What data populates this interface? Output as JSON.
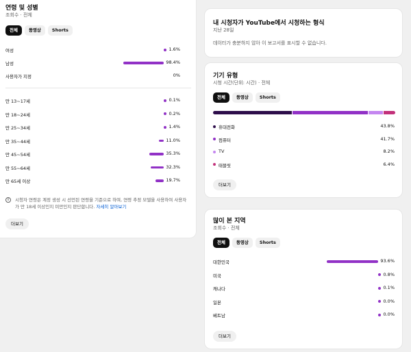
{
  "age_gender": {
    "title": "연령 및 성별",
    "subtitle": "조회수 · 전체",
    "chips": [
      "전체",
      "동영상",
      "Shorts"
    ],
    "gender": [
      {
        "label": "여성",
        "value": "1.6%",
        "pct": 1.6
      },
      {
        "label": "남성",
        "value": "98.4%",
        "pct": 98.4
      },
      {
        "label": "사용자가 지정",
        "value": "0%",
        "pct": 0
      }
    ],
    "ages": [
      {
        "label": "만 13~17세",
        "value": "0.1%",
        "pct": 0.1
      },
      {
        "label": "만 18~24세",
        "value": "0.2%",
        "pct": 0.2
      },
      {
        "label": "만 25~34세",
        "value": "1.4%",
        "pct": 1.4
      },
      {
        "label": "만 35~44세",
        "value": "11.0%",
        "pct": 11.0
      },
      {
        "label": "만 45~54세",
        "value": "35.3%",
        "pct": 35.3
      },
      {
        "label": "만 55~64세",
        "value": "32.3%",
        "pct": 32.3
      },
      {
        "label": "만 65세 이상",
        "value": "19.7%",
        "pct": 19.7
      }
    ],
    "info_text": "시청자 연령은 계정 생성 시 선언된 연령을 기준으로 하며, 연령 추정 모델을 사용하여 사용자가 만 18세 이상인지 미만인지 판단합니다.",
    "info_link": "자세히 알아보기",
    "more_label": "더보기"
  },
  "watch_format": {
    "title": "내 시청자가 YouTube에서 시청하는 형식",
    "subtitle": "지난 28일",
    "notice": "데이터가 충분하지 않아 이 보고서를 표시할 수 없습니다."
  },
  "device_type": {
    "title": "기기 유형",
    "subtitle": "시청 시간(단위: 시간) · 전체",
    "chips": [
      "전체",
      "동영상",
      "Shorts"
    ],
    "items": [
      {
        "label": "휴대전화",
        "value": "43.8%",
        "pct": 43.8,
        "color": "#2d0d4a"
      },
      {
        "label": "컴퓨터",
        "value": "41.7%",
        "pct": 41.7,
        "color": "#9131c6"
      },
      {
        "label": "TV",
        "value": "8.2%",
        "pct": 8.2,
        "color": "#c486f0"
      },
      {
        "label": "태블릿",
        "value": "6.4%",
        "pct": 6.4,
        "color": "#c2307a"
      }
    ],
    "more_label": "더보기"
  },
  "top_regions": {
    "title": "많이 본 지역",
    "subtitle": "조회수 · 전체",
    "chips": [
      "전체",
      "동영상",
      "Shorts"
    ],
    "items": [
      {
        "label": "대한민국",
        "value": "93.6%",
        "pct": 93.6
      },
      {
        "label": "미국",
        "value": "0.8%",
        "pct": 0.8
      },
      {
        "label": "캐나다",
        "value": "0.1%",
        "pct": 0.1
      },
      {
        "label": "일본",
        "value": "0.0%",
        "pct": 0.0
      },
      {
        "label": "베트남",
        "value": "0.0%",
        "pct": 0.0
      }
    ],
    "more_label": "더보기"
  },
  "colors": {
    "accent": "#9131c6",
    "link": "#065fd4"
  }
}
